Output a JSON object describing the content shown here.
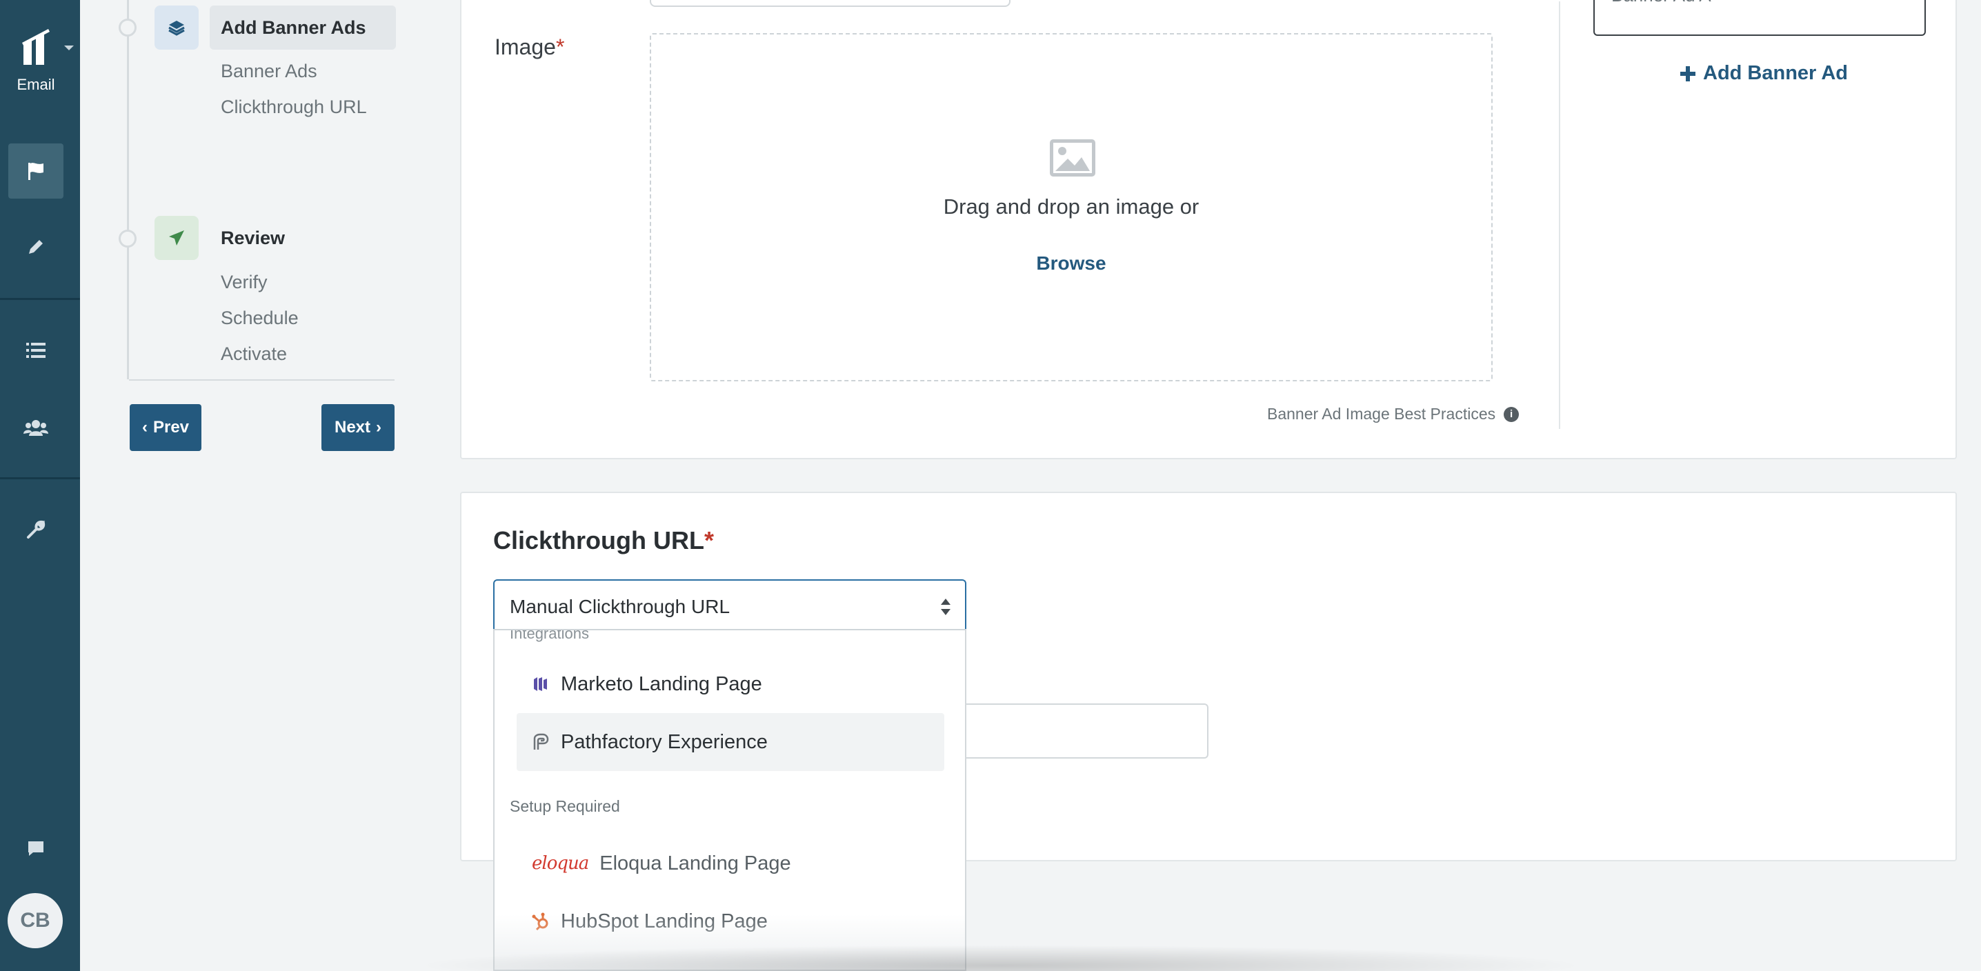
{
  "app": {
    "product_label": "Email",
    "user_initials": "CB"
  },
  "rail": {
    "icons": [
      "logo-icon",
      "flag-icon",
      "pencil-icon",
      "list-icon",
      "users-icon",
      "wrench-icon",
      "chat-icon"
    ]
  },
  "steps": {
    "add_banner_ads": {
      "title": "Add Banner Ads",
      "subitems": [
        "Banner Ads",
        "Clickthrough URL"
      ]
    },
    "review": {
      "title": "Review",
      "subitems": [
        "Verify",
        "Schedule",
        "Activate"
      ]
    }
  },
  "nav": {
    "prev_label": "Prev",
    "next_label": "Next"
  },
  "image_card": {
    "label": "Image",
    "required_mark": "*",
    "dropzone_text": "Drag and drop an image or",
    "browse_label": "Browse",
    "best_practices_label": "Banner Ad Image Best Practices",
    "banner_box_label": "Banner Ad A",
    "add_banner_label": "Add Banner Ad"
  },
  "clickthrough_card": {
    "title": "Clickthrough URL",
    "required_mark": "*",
    "select_value": "Manual Clickthrough URL"
  },
  "dropdown": {
    "group_cut_label": "Integrations",
    "items_integrations": [
      {
        "label": "Marketo Landing Page",
        "icon": "marketo-icon"
      },
      {
        "label": "Pathfactory Experience",
        "icon": "pathfactory-icon"
      }
    ],
    "setup_required_label": "Setup Required",
    "items_setup": [
      {
        "label": "Eloqua Landing Page",
        "icon": "eloqua-icon",
        "logo_text": "eloqua"
      },
      {
        "label": "HubSpot Landing Page",
        "icon": "hubspot-icon"
      }
    ]
  },
  "colors": {
    "rail_bg": "#234b5e",
    "primary": "#24597e",
    "required": "#c0392b",
    "eloqua": "#d23a2f",
    "hubspot": "#e0703a",
    "marketo": "#5a4fa8"
  }
}
